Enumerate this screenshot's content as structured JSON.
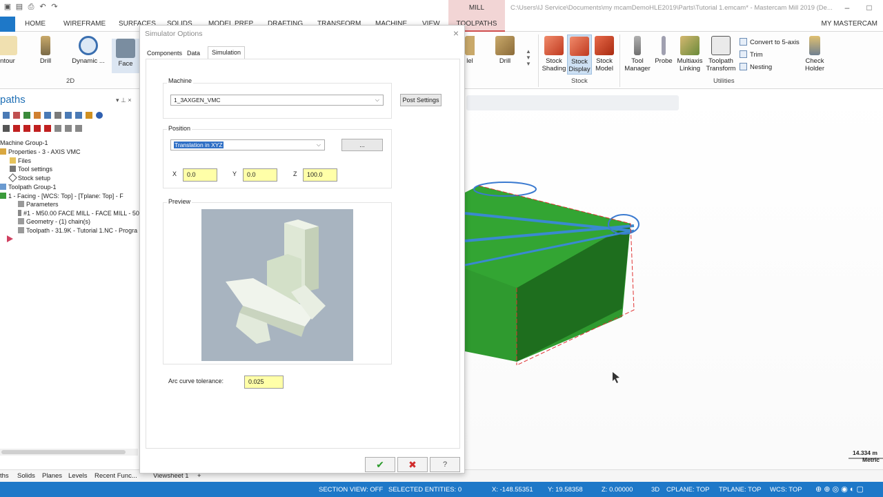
{
  "window": {
    "title": "C:\\Users\\IJ Service\\Documents\\my mcamDemoHLE2019\\Parts\\Tutorial 1.emcam* - Mastercam Mill 2019 (De...",
    "context_tab": "MILL"
  },
  "ribbon_tabs": [
    "HOME",
    "WIREFRAME",
    "SURFACES",
    "SOLIDS",
    "MODEL PREP",
    "DRAFTING",
    "TRANSFORM",
    "MACHINE",
    "VIEW",
    "TOOLPATHS",
    "MY MASTERCAM"
  ],
  "ribbon": {
    "left_buttons": [
      "ntour",
      "Drill",
      "Dynamic ...",
      "Face"
    ],
    "group_2d": "2D",
    "mid_buttons": [
      "lel",
      "Drill"
    ],
    "stock_buttons": [
      "Stock\nShading",
      "Stock\nDisplay",
      "Stock\nModel"
    ],
    "group_stock": "Stock",
    "utility_buttons": [
      "Tool\nManager",
      "Probe",
      "Multiaxis\nLinking",
      "Toolpath\nTransform"
    ],
    "small_buttons": [
      "Convert to 5-axis",
      "Trim",
      "Nesting"
    ],
    "check_holder": "Check\nHolder",
    "group_utilities": "Utilities"
  },
  "left_panel": {
    "title": "paths",
    "tree": [
      "Machine Group-1",
      "Properties - 3 - AXIS VMC",
      "Files",
      "Tool settings",
      "Stock setup",
      "Toolpath Group-1",
      "1 - Facing - [WCS: Top] - [Tplane: Top] - F",
      "Parameters",
      "#1 - M50.00 FACE MILL - FACE MILL - 50",
      "Geometry - (1) chain(s)",
      "Toolpath - 31.9K - Tutorial 1.NC - Progra"
    ]
  },
  "bottom_tabs": [
    "ths",
    "Solids",
    "Planes",
    "Levels",
    "Recent Func..."
  ],
  "viewsheet": {
    "label": "Viewsheet 1",
    "add": "+"
  },
  "dialog": {
    "title": "Simulator Options",
    "close": "×",
    "tabs": [
      "Components",
      "Data",
      "Simulation"
    ],
    "machine_label": "Machine",
    "machine_value": "1_3AXGEN_VMC",
    "post_settings": "Post Settings",
    "position_label": "Position",
    "position_value": "Translation in XYZ",
    "ellipsis": "...",
    "x_label": "X",
    "x_value": "0.0",
    "y_label": "Y",
    "y_value": "0.0",
    "z_label": "Z",
    "z_value": "100.0",
    "preview_label": "Preview",
    "arc_label": "Arc curve tolerance:",
    "arc_value": "0.025",
    "ok": "✔",
    "cancel": "✖",
    "help": "?"
  },
  "viewport": {
    "scale_value": "14.334 m",
    "scale_unit": "Metric"
  },
  "status": {
    "section_view": "SECTION VIEW: OFF",
    "selected": "SELECTED ENTITIES: 0",
    "x": "X:   -148.55351",
    "y": "Y:   19.58358",
    "z": "Z:   0.00000",
    "mode": "3D",
    "cplane": "CPLANE: TOP",
    "tplane": "TPLANE: TOP",
    "wcs": "WCS: TOP"
  },
  "colors": {
    "accent": "#1e78c8",
    "context": "#f2d5d5",
    "input_bg": "#ffffa8",
    "part_green": "#2f9a2f"
  }
}
